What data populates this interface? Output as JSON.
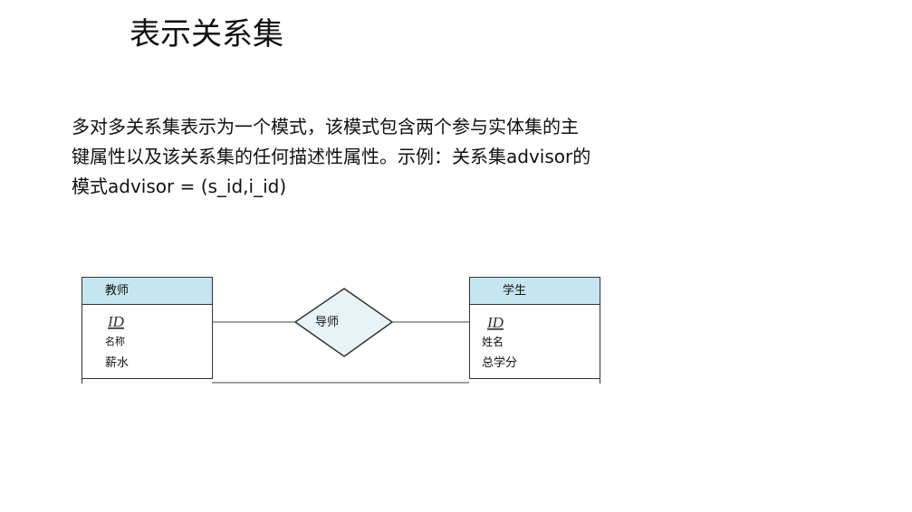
{
  "slide": {
    "title": "表示关系集",
    "body_lines": [
      "多对多关系集表示为一个模式，该模式包含两个参与实体集的主",
      "键属性以及该关系集的任何描述性属性。示例：关系集advisor的",
      "模式advisor = (s_id,i_id)"
    ]
  },
  "diagram": {
    "entity_left": {
      "name": "教师",
      "key": "ID",
      "attributes": [
        "名称",
        "薪水"
      ]
    },
    "relationship": {
      "name": "导师"
    },
    "entity_right": {
      "name": "学生",
      "key": "ID",
      "attributes": [
        "姓名",
        "总学分"
      ]
    },
    "colors": {
      "entity_header": "#c5e6f0",
      "relationship_fill": "#e9f3f7",
      "stroke": "#333333"
    }
  }
}
